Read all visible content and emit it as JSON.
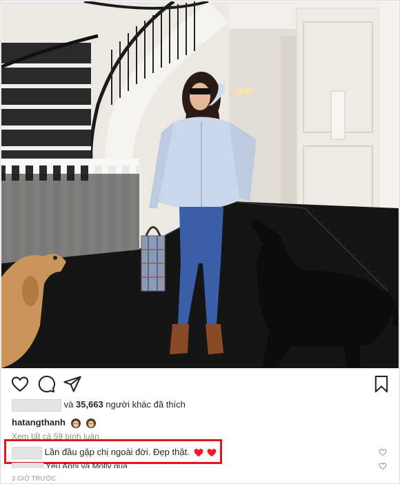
{
  "post": {
    "image": {
      "alt": ""
    },
    "actions": {
      "like_icon": "heart-outline-icon",
      "comment_icon": "comment-bubble-icon",
      "share_icon": "paper-plane-icon",
      "save_icon": "bookmark-icon"
    },
    "likes": {
      "count_text": "35,663",
      "suffix_text": "người khác đã thích",
      "connector": "và"
    },
    "caption": {
      "username": "hatangthanh"
    },
    "view_all_comments": "Xem tất cả 59 bình luận",
    "comments": [
      {
        "text": "Lần đầu gặp chị ngoài đời. Đẹp thật.",
        "has_hearts": true
      },
      {
        "text": "Yêu Apni và Molly quá"
      }
    ],
    "timestamp": "3 GIỜ TRƯỚC",
    "colors": {
      "highlight": "#e8141c",
      "heart": "#ed1c24",
      "muted": "#8e8e8e"
    }
  }
}
